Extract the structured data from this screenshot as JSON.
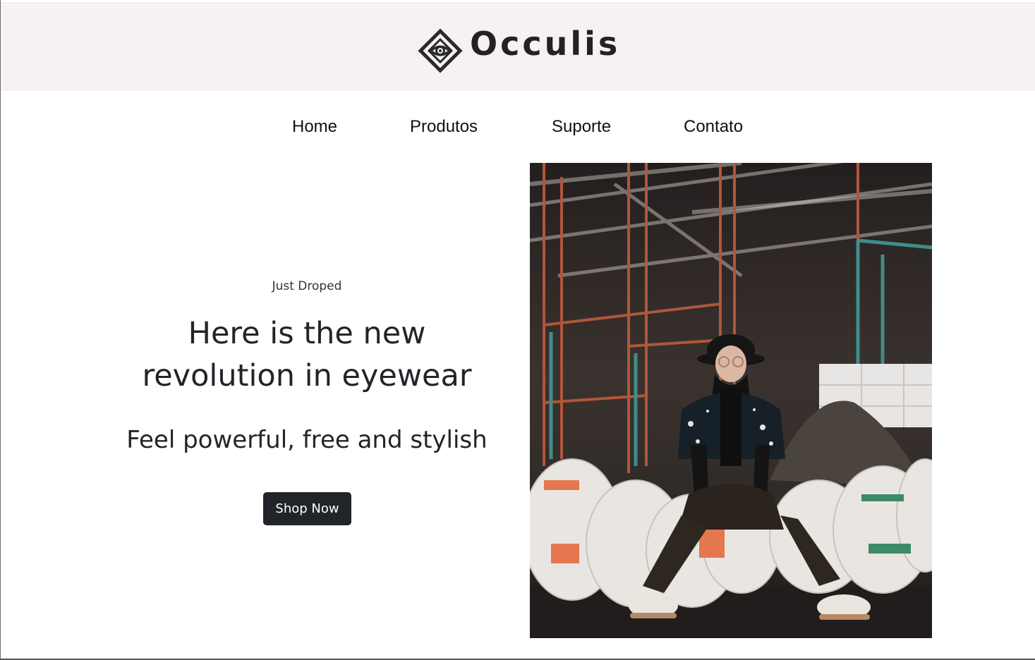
{
  "header": {
    "brand_name": "Occulis",
    "logo_icon": "eye-in-diamond-icon",
    "background": "#f7f2f1"
  },
  "nav": {
    "items": [
      {
        "label": "Home"
      },
      {
        "label": "Produtos"
      },
      {
        "label": "Suporte"
      },
      {
        "label": "Contato"
      }
    ]
  },
  "hero": {
    "eyebrow": "Just Droped",
    "headline_line1": "Here is the new",
    "headline_line2": "revolution in eyewear",
    "subline": "Feel powerful, free and stylish",
    "cta_label": "Shop Now",
    "cta_color": "#212529"
  },
  "image": {
    "subject": "hero-photo"
  }
}
